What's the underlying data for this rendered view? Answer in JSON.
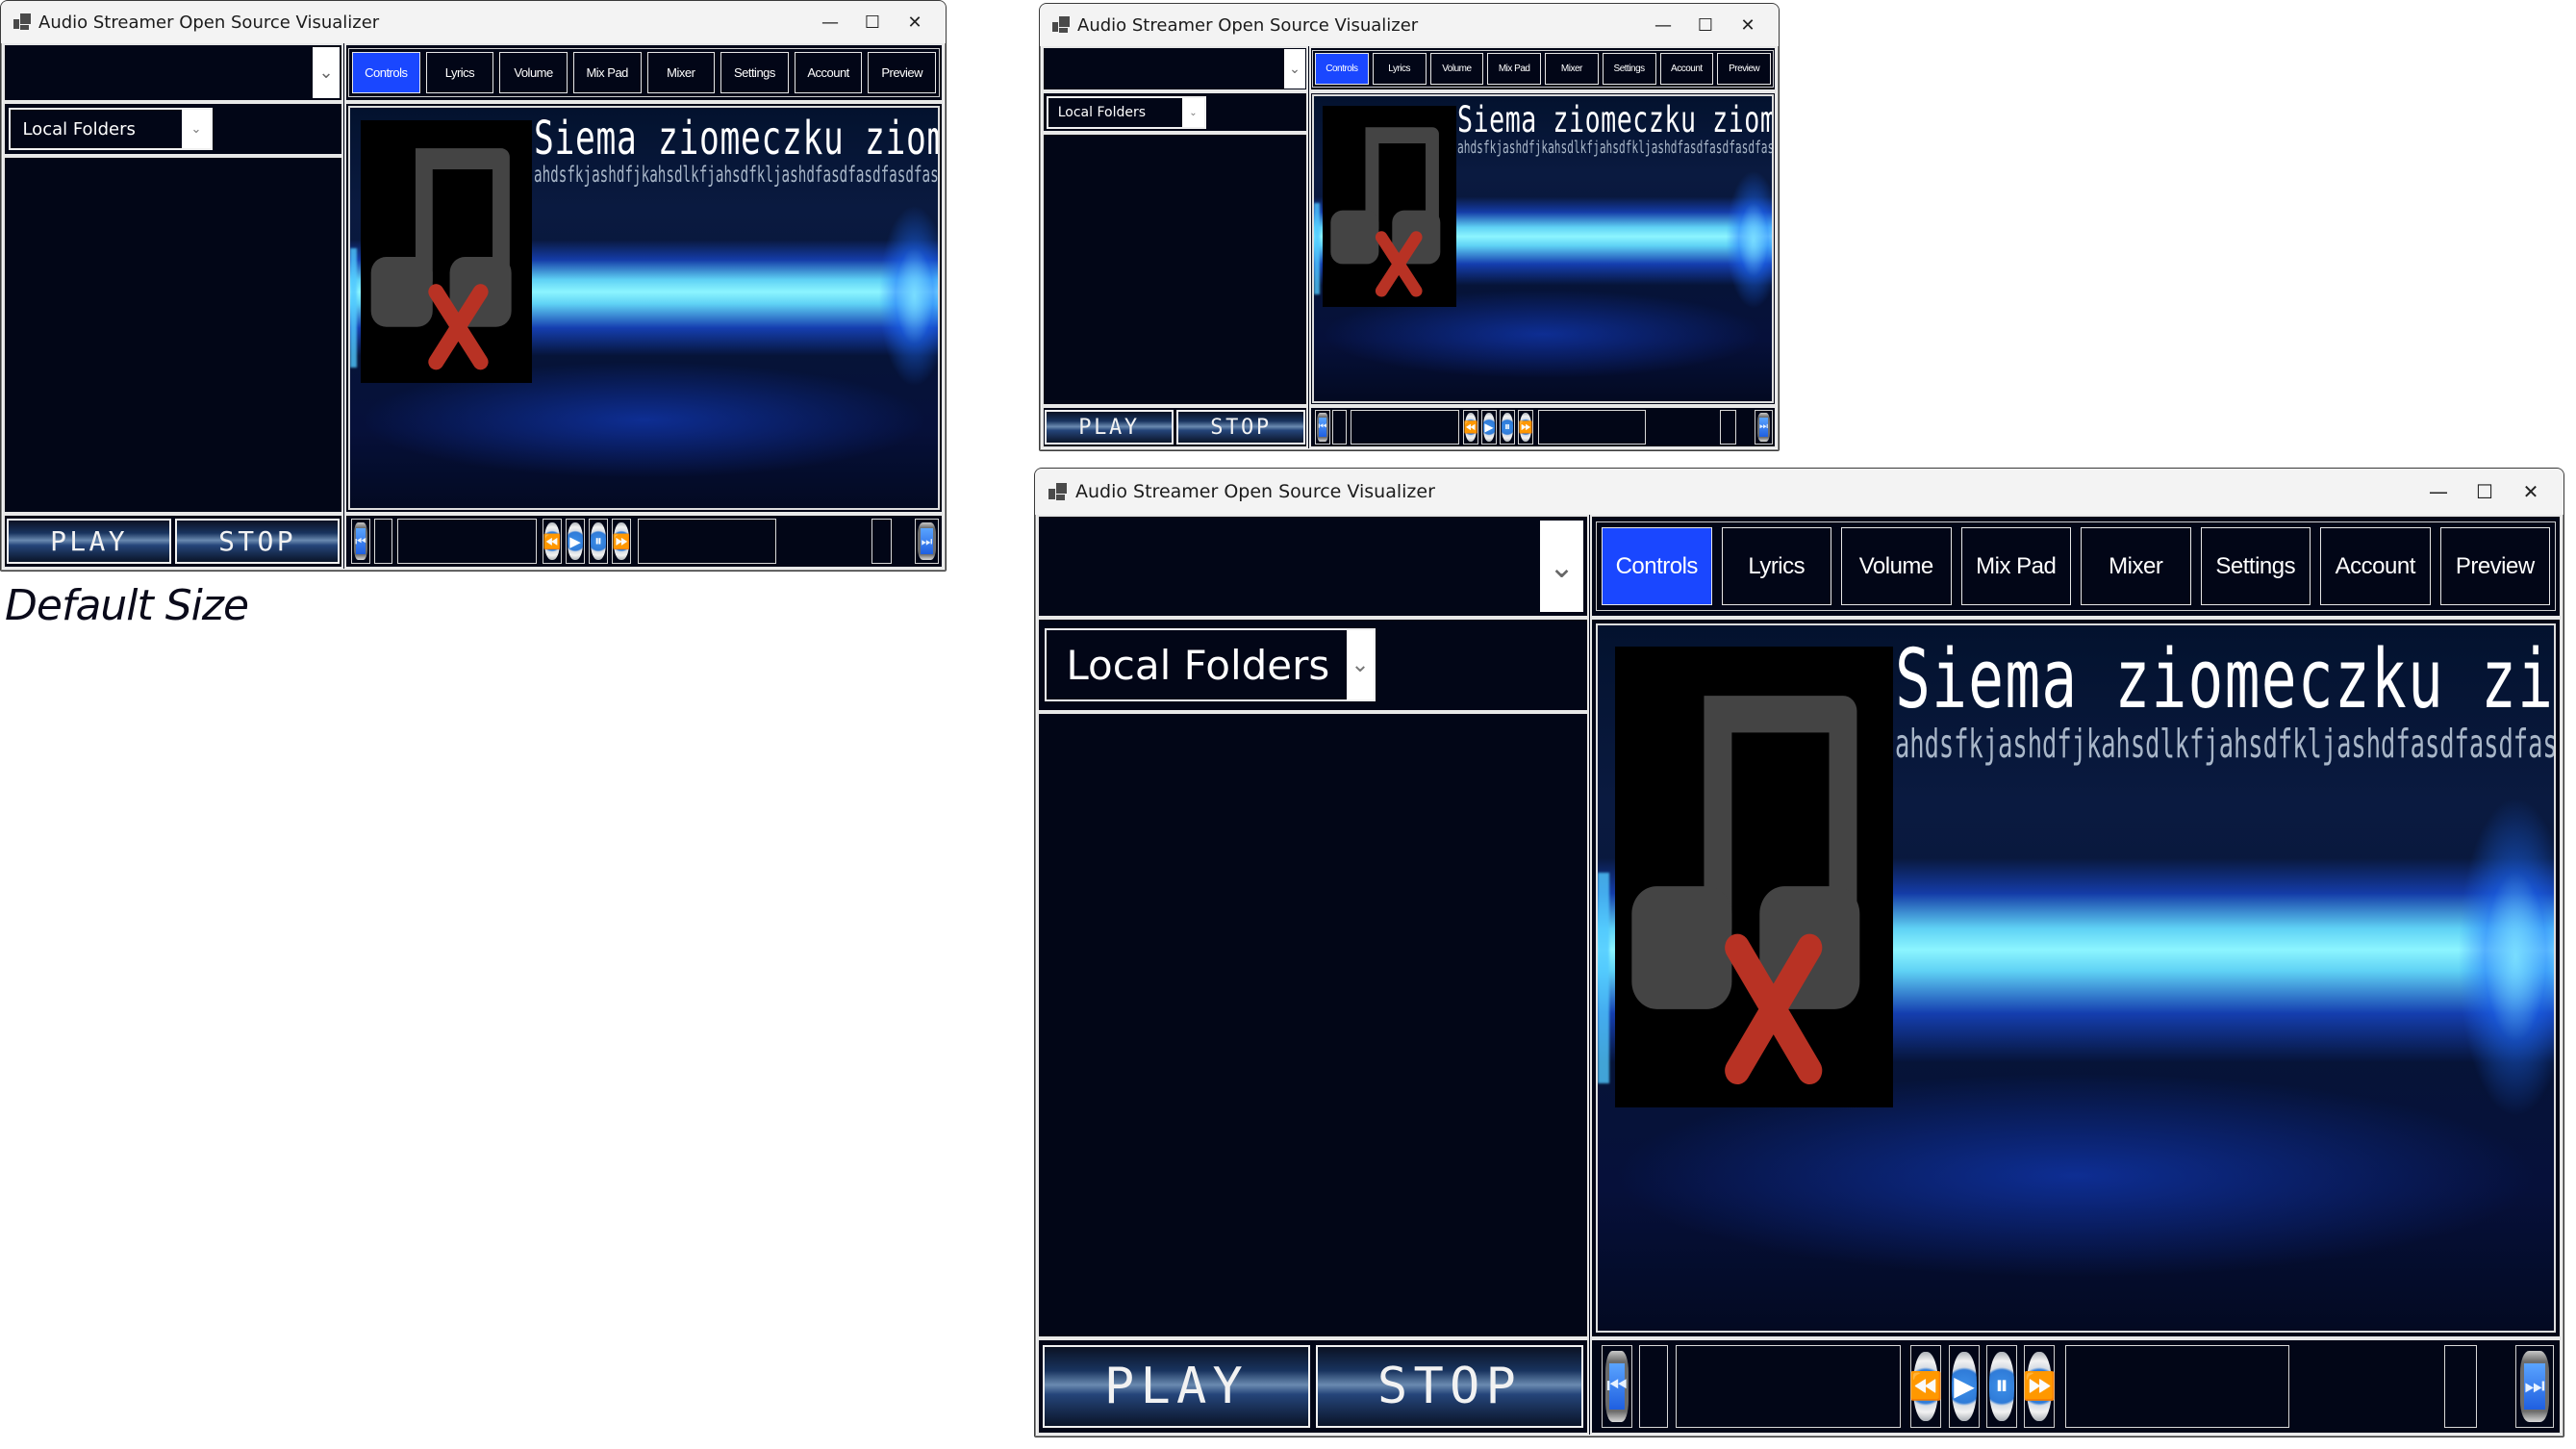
{
  "app": {
    "title": "Audio Streamer Open Source Visualizer",
    "window_controls": {
      "minimize": "—",
      "maximize": "☐",
      "close": "✕"
    },
    "source_dropdown": {
      "value": "",
      "arrow": "⌄"
    },
    "tabs": [
      {
        "label": "Controls",
        "active": true
      },
      {
        "label": "Lyrics",
        "active": false
      },
      {
        "label": "Volume",
        "active": false
      },
      {
        "label": "Mix Pad",
        "active": false
      },
      {
        "label": "Mixer",
        "active": false
      },
      {
        "label": "Settings",
        "active": false
      },
      {
        "label": "Account",
        "active": false
      },
      {
        "label": "Preview",
        "active": false
      }
    ],
    "folder_select": {
      "value": "Local Folders",
      "arrow": "⌄"
    },
    "now_playing": {
      "title": "Siema ziomeczku ziomalisty",
      "subtitle": "ahdsfkjashdfjkahsdlkfjahsdfkljashdfasdfasdfasdfasdf",
      "album_art": "missing-music-note-icon"
    },
    "buttons": {
      "play": "PLAY",
      "stop": "STOP"
    },
    "transport": {
      "skip_back": "⏮",
      "rewind": "⏪",
      "play": "▶",
      "pause": "⏸",
      "fast_forward": "⏩",
      "skip_forward": "⏭"
    },
    "colors": {
      "active_tab": "#1a47ff",
      "background": "#020617",
      "missing_x": "#b83224"
    }
  },
  "captions": {
    "default_size": "Default Size"
  }
}
